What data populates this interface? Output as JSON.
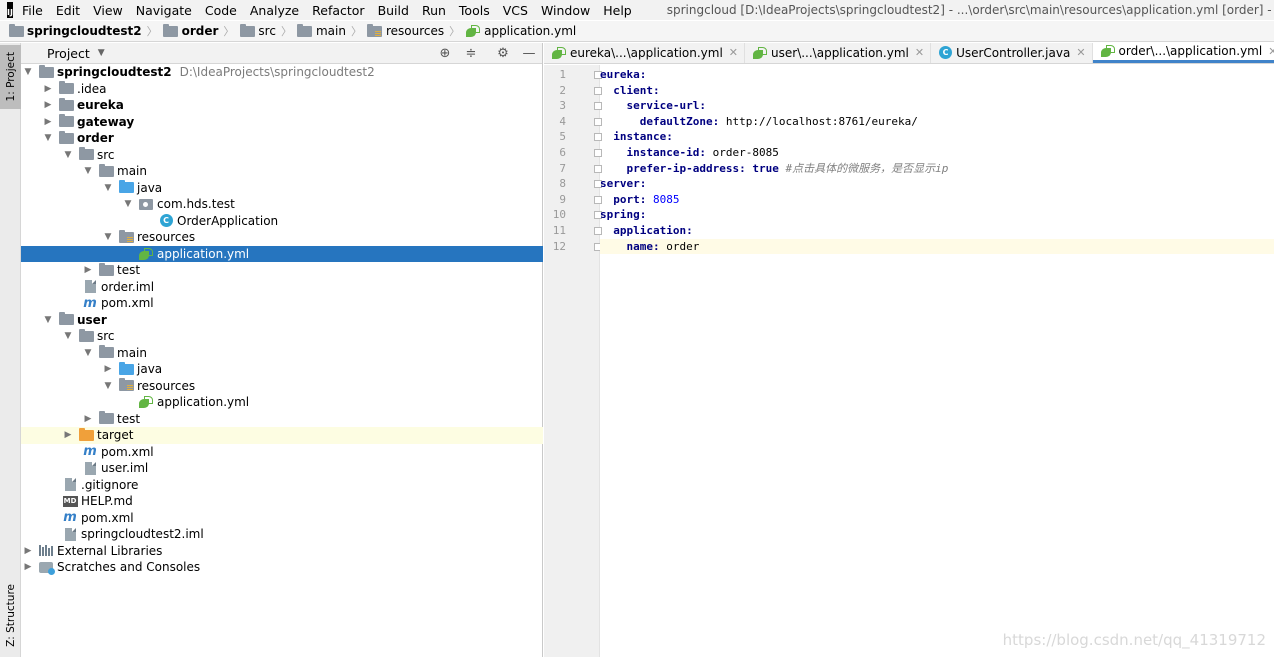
{
  "menubar": {
    "logo": "IJ",
    "items": [
      "File",
      "Edit",
      "View",
      "Navigate",
      "Code",
      "Analyze",
      "Refactor",
      "Build",
      "Run",
      "Tools",
      "VCS",
      "Window",
      "Help"
    ],
    "window_title": "springcloud [D:\\IdeaProjects\\springcloudtest2] - ...\\order\\src\\main\\resources\\application.yml [order] - IntelliJ"
  },
  "breadcrumb": [
    "springcloudtest2",
    "order",
    "src",
    "main",
    "resources",
    "application.yml"
  ],
  "toolstrip": {
    "project_tab": "1: Project",
    "structure_tab": "Z: Structure"
  },
  "project_panel": {
    "title": "Project",
    "tree": [
      {
        "label": "springcloudtest2",
        "path": "D:\\IdeaProjects\\springcloudtest2",
        "icon": "folder-icon",
        "bold": true,
        "expanded": true
      },
      {
        "label": ".idea",
        "icon": "folder-icon",
        "expanded": false
      },
      {
        "label": "eureka",
        "icon": "module-folder-icon",
        "bold": true,
        "expanded": false
      },
      {
        "label": "gateway",
        "icon": "module-folder-icon",
        "bold": true,
        "expanded": false
      },
      {
        "label": "order",
        "icon": "module-folder-icon",
        "bold": true,
        "expanded": true
      },
      {
        "label": "src",
        "icon": "folder-icon",
        "expanded": true
      },
      {
        "label": "main",
        "icon": "folder-icon",
        "expanded": true
      },
      {
        "label": "java",
        "icon": "source-folder-icon",
        "expanded": true
      },
      {
        "label": "com.hds.test",
        "icon": "package-icon",
        "expanded": true
      },
      {
        "label": "OrderApplication",
        "icon": "class-icon"
      },
      {
        "label": "resources",
        "icon": "resources-folder-icon",
        "expanded": true
      },
      {
        "label": "application.yml",
        "icon": "yaml-file-icon",
        "selected": true
      },
      {
        "label": "test",
        "icon": "folder-icon",
        "expanded": false
      },
      {
        "label": "order.iml",
        "icon": "iml-file-icon"
      },
      {
        "label": "pom.xml",
        "icon": "maven-icon"
      },
      {
        "label": "user",
        "icon": "module-folder-icon",
        "bold": true,
        "expanded": true
      },
      {
        "label": "src",
        "icon": "folder-icon",
        "expanded": true
      },
      {
        "label": "main",
        "icon": "folder-icon",
        "expanded": true
      },
      {
        "label": "java",
        "icon": "source-folder-icon",
        "expanded": false
      },
      {
        "label": "resources",
        "icon": "resources-folder-icon",
        "expanded": true
      },
      {
        "label": "application.yml",
        "icon": "yaml-file-icon"
      },
      {
        "label": "test",
        "icon": "folder-icon",
        "expanded": false
      },
      {
        "label": "target",
        "icon": "excluded-folder-icon",
        "expanded": false,
        "highlighted": true
      },
      {
        "label": "pom.xml",
        "icon": "maven-icon"
      },
      {
        "label": "user.iml",
        "icon": "iml-file-icon"
      },
      {
        "label": ".gitignore",
        "icon": "file-icon"
      },
      {
        "label": "HELP.md",
        "icon": "markdown-icon"
      },
      {
        "label": "pom.xml",
        "icon": "maven-icon"
      },
      {
        "label": "springcloudtest2.iml",
        "icon": "iml-file-icon"
      },
      {
        "label": "External Libraries",
        "icon": "libraries-icon",
        "expanded": false
      },
      {
        "label": "Scratches and Consoles",
        "icon": "scratches-icon",
        "expanded": false
      }
    ]
  },
  "editor": {
    "tabs": [
      {
        "label": "eureka\\...\\application.yml",
        "icon": "yaml-file-icon"
      },
      {
        "label": "user\\...\\application.yml",
        "icon": "yaml-file-icon"
      },
      {
        "label": "UserController.java",
        "icon": "class-icon"
      },
      {
        "label": "order\\...\\application.yml",
        "icon": "yaml-file-icon",
        "active": true
      }
    ],
    "line_numbers": [
      "1",
      "2",
      "3",
      "4",
      "5",
      "6",
      "7",
      "8",
      "9",
      "10",
      "11",
      "12"
    ],
    "lines": [
      {
        "indent": "",
        "key": "eureka",
        "sep": ":",
        "value": ""
      },
      {
        "indent": "  ",
        "key": "client",
        "sep": ":",
        "value": ""
      },
      {
        "indent": "    ",
        "key": "service-url",
        "sep": ":",
        "value": ""
      },
      {
        "indent": "      ",
        "key": "defaultZone",
        "sep": ":",
        "value": " http://localhost:8761/eureka/"
      },
      {
        "indent": "  ",
        "key": "instance",
        "sep": ":",
        "value": ""
      },
      {
        "indent": "    ",
        "key": "instance-id",
        "sep": ":",
        "value": " order-8085"
      },
      {
        "indent": "    ",
        "key": "prefer-ip-address",
        "sep": ":",
        "value": " ",
        "kw": "true",
        "comment": " #点击具体的微服务，是否显示ip"
      },
      {
        "indent": "",
        "key": "server",
        "sep": ":",
        "value": ""
      },
      {
        "indent": "  ",
        "key": "port",
        "sep": ":",
        "value": " ",
        "number": "8085"
      },
      {
        "indent": "",
        "key": "spring",
        "sep": ":",
        "value": ""
      },
      {
        "indent": "  ",
        "key": "application",
        "sep": ":",
        "value": ""
      },
      {
        "indent": "    ",
        "key": "name",
        "sep": ":",
        "value": " order",
        "current": true
      }
    ]
  },
  "watermark": "https://blog.csdn.net/qq_41319712",
  "colors": {
    "selection": "#2675bf",
    "yaml_key": "#000080",
    "number": "#0000ff",
    "comment": "#808080"
  }
}
